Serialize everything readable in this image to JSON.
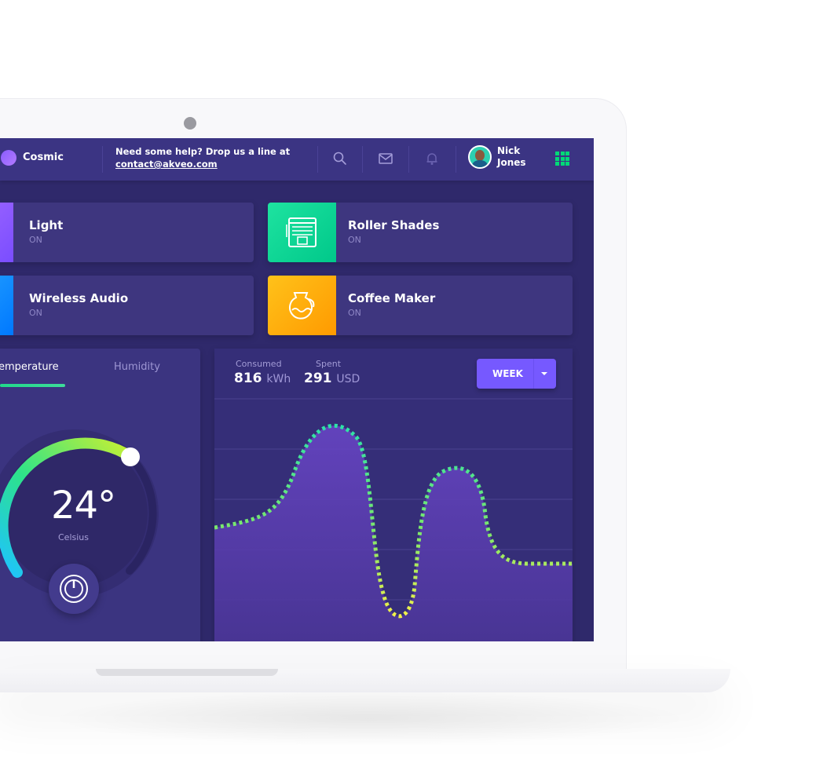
{
  "header": {
    "brand": "Cosmic",
    "help_line1": "Need some help? Drop us a line at",
    "help_email": "contact@akveo.com",
    "user_first": "Nick",
    "user_last": "Jones",
    "icons": [
      "search-icon",
      "mail-icon",
      "bell-icon",
      "apps-grid-icon"
    ]
  },
  "devices": [
    {
      "title": "Light",
      "status": "ON",
      "icon": "light-icon",
      "color": "#8b5cf6"
    },
    {
      "title": "Roller Shades",
      "status": "ON",
      "icon": "roller-shades-icon",
      "color": "#00d68f"
    },
    {
      "title": "Wireless Audio",
      "status": "ON",
      "icon": "audio-icon",
      "color": "#0095ff"
    },
    {
      "title": "Coffee Maker",
      "status": "ON",
      "icon": "coffee-maker-icon",
      "color": "#ffaa00"
    }
  ],
  "temperature": {
    "tab_temperature": "emperature",
    "tab_humidity": "Humidity",
    "value": "24°",
    "unit": "Celsius"
  },
  "electricity": {
    "consumed_label": "Consumed",
    "consumed_value": "816",
    "consumed_unit": "kWh",
    "spent_label": "Spent",
    "spent_value": "291",
    "spent_unit": "USD",
    "period_button": "WEEK"
  },
  "colors": {
    "background": "#2f296b",
    "header": "#3b3483",
    "card": "#3e367f",
    "accent": "#7659ff",
    "success": "#00d977"
  }
}
